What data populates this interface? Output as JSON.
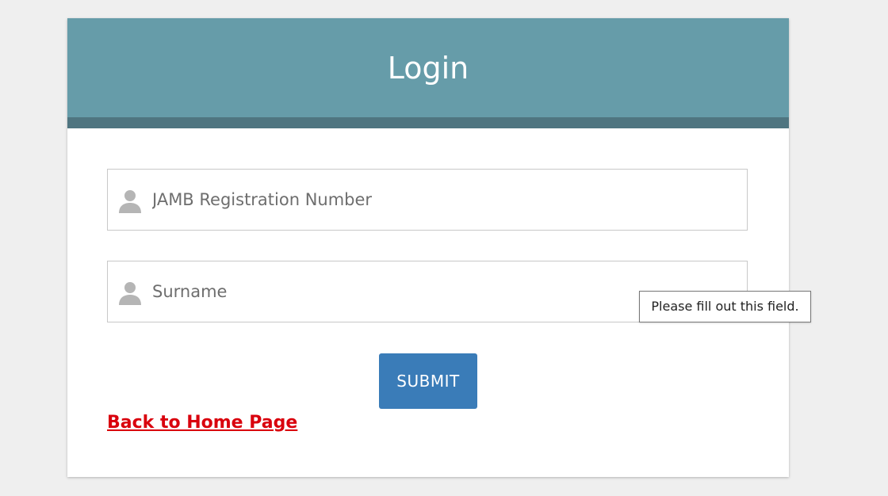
{
  "header": {
    "title": "Login"
  },
  "form": {
    "registration_field": {
      "value": "",
      "placeholder": "JAMB Registration Number",
      "icon": "user-icon"
    },
    "surname_field": {
      "value": "",
      "placeholder": "Surname",
      "icon": "user-icon"
    },
    "submit_label": "SUBMIT"
  },
  "links": {
    "back_home": "Back to Home Page"
  },
  "tooltip": {
    "text": "Please fill out this field."
  },
  "colors": {
    "page_background": "#efefef",
    "header": "#669ca9",
    "header_strip": "#4f7580",
    "submit_button": "#3a7cb8",
    "link": "#d9000d"
  }
}
